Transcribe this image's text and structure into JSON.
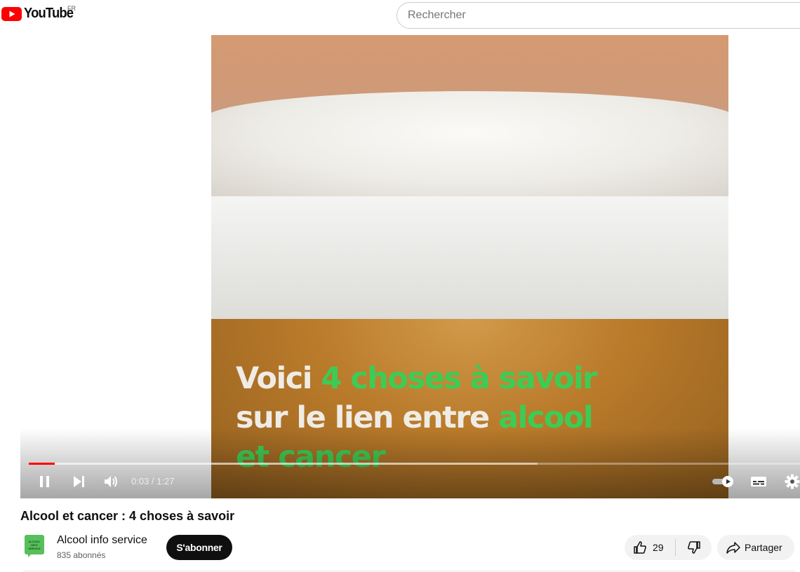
{
  "masthead": {
    "logo_text": "YouTube",
    "country_code": "FR",
    "search_placeholder": "Rechercher"
  },
  "player": {
    "caption": {
      "line1_white": "Voici ",
      "line1_green": "4 choses à savoir",
      "line2_white": "sur le lien entre ",
      "line2_green": "alcool",
      "line3_green": "et cancer"
    },
    "time_display": "0:03 / 1:27",
    "progress_played_fraction": 0.034,
    "state": "playing",
    "icons": [
      "pause-icon",
      "next-icon",
      "volume-icon",
      "autoplay-toggle-icon",
      "subtitles-icon",
      "settings-icon"
    ]
  },
  "video": {
    "title": "Alcool et cancer : 4 choses à savoir"
  },
  "channel": {
    "name": "Alcool info service",
    "subscribers": "835 abonnés",
    "avatar_lines": [
      "ALCOOL",
      "INFO",
      "SERVICE"
    ],
    "avatar_color": "#56c05b"
  },
  "actions": {
    "subscribe_label": "S'abonner",
    "like_count": "29",
    "share_label": "Partager"
  },
  "colors": {
    "accent_red": "#ff0000",
    "caption_green": "#3ecb55",
    "subscribe_bg": "#0f0f0f"
  }
}
